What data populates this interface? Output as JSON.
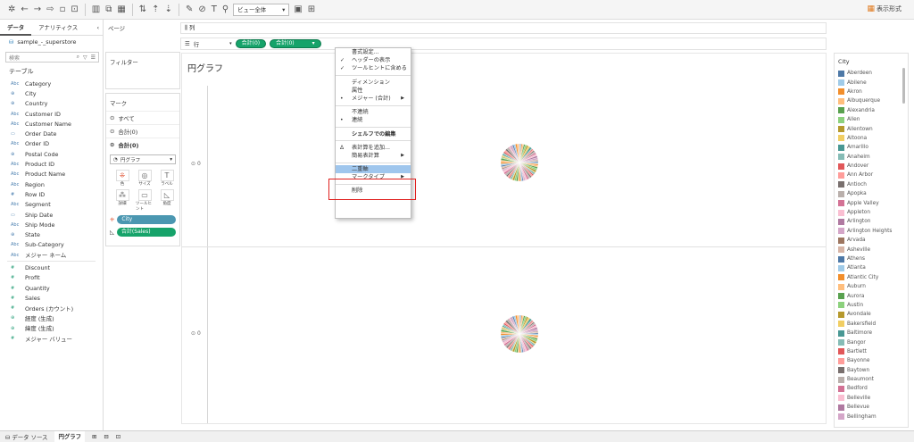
{
  "toolbar": {
    "view_select": "ビュー全体",
    "show_me": "表示形式"
  },
  "left_panel": {
    "tabs": [
      "データ",
      "アナリティクス"
    ],
    "datasource": "sample_-_superstore",
    "search_placeholder": "検索",
    "tables_header": "テーブル",
    "fields": [
      {
        "type": "Abc",
        "name": "Category"
      },
      {
        "type": "⊕",
        "name": "City"
      },
      {
        "type": "⊕",
        "name": "Country"
      },
      {
        "type": "Abc",
        "name": "Customer ID"
      },
      {
        "type": "Abc",
        "name": "Customer Name"
      },
      {
        "type": "▭",
        "name": "Order Date"
      },
      {
        "type": "Abc",
        "name": "Order ID"
      },
      {
        "type": "⊕",
        "name": "Postal Code"
      },
      {
        "type": "Abc",
        "name": "Product ID"
      },
      {
        "type": "Abc",
        "name": "Product Name"
      },
      {
        "type": "Abc",
        "name": "Region"
      },
      {
        "type": "#",
        "name": "Row ID"
      },
      {
        "type": "Abc",
        "name": "Segment"
      },
      {
        "type": "▭",
        "name": "Ship Date"
      },
      {
        "type": "Abc",
        "name": "Ship Mode"
      },
      {
        "type": "⊕",
        "name": "State"
      },
      {
        "type": "Abc",
        "name": "Sub-Category"
      },
      {
        "type": "Abc",
        "name": "メジャー ネーム"
      }
    ],
    "measures": [
      {
        "type": "#",
        "name": "Discount"
      },
      {
        "type": "#",
        "name": "Profit"
      },
      {
        "type": "#",
        "name": "Quantity"
      },
      {
        "type": "#",
        "name": "Sales"
      },
      {
        "type": "#",
        "name": "Orders (カウント)"
      },
      {
        "type": "⊕",
        "name": "経度 (生成)"
      },
      {
        "type": "⊕",
        "name": "緯度 (生成)"
      },
      {
        "type": "#",
        "name": "メジャー バリュー"
      }
    ]
  },
  "pages_label": "ページ",
  "filters_label": "フィルター",
  "marks": {
    "header": "マーク",
    "rows": [
      "すべて",
      "合計(0)",
      "合計(0)"
    ],
    "mark_type": "円グラフ",
    "buttons": [
      "色",
      "サイズ",
      "ラベル",
      "詳細",
      "ツールヒント",
      "角度"
    ],
    "pill_city": "City",
    "pill_sales": "合計(Sales)"
  },
  "shelves": {
    "columns_label": "列",
    "rows_label": "行",
    "pill1": "合計(0)",
    "pill2": "合計(0)"
  },
  "view": {
    "title": "円グラフ",
    "row_label": "0"
  },
  "legend": {
    "title": "City",
    "items": [
      {
        "name": "Aberdeen",
        "color": "#4e79a7"
      },
      {
        "name": "Abilene",
        "color": "#a0cbe8"
      },
      {
        "name": "Akron",
        "color": "#f28e2b"
      },
      {
        "name": "Albuquerque",
        "color": "#ffbe7d"
      },
      {
        "name": "Alexandria",
        "color": "#59a14f"
      },
      {
        "name": "Allen",
        "color": "#8cd17d"
      },
      {
        "name": "Allentown",
        "color": "#b6992d"
      },
      {
        "name": "Altoona",
        "color": "#f1ce63"
      },
      {
        "name": "Amarillo",
        "color": "#499894"
      },
      {
        "name": "Anaheim",
        "color": "#86bcb6"
      },
      {
        "name": "Andover",
        "color": "#e15759"
      },
      {
        "name": "Ann Arbor",
        "color": "#ff9d9a"
      },
      {
        "name": "Antioch",
        "color": "#79706e"
      },
      {
        "name": "Apopka",
        "color": "#bab0ac"
      },
      {
        "name": "Apple Valley",
        "color": "#d37295"
      },
      {
        "name": "Appleton",
        "color": "#fabfd2"
      },
      {
        "name": "Arlington",
        "color": "#b07aa1"
      },
      {
        "name": "Arlington Heights",
        "color": "#d4a6c8"
      },
      {
        "name": "Arvada",
        "color": "#9d7660"
      },
      {
        "name": "Asheville",
        "color": "#d7b5a6"
      },
      {
        "name": "Athens",
        "color": "#4e79a7"
      },
      {
        "name": "Atlanta",
        "color": "#a0cbe8"
      },
      {
        "name": "Atlantic City",
        "color": "#f28e2b"
      },
      {
        "name": "Auburn",
        "color": "#ffbe7d"
      },
      {
        "name": "Aurora",
        "color": "#59a14f"
      },
      {
        "name": "Austin",
        "color": "#8cd17d"
      },
      {
        "name": "Avondale",
        "color": "#b6992d"
      },
      {
        "name": "Bakersfield",
        "color": "#f1ce63"
      },
      {
        "name": "Baltimore",
        "color": "#499894"
      },
      {
        "name": "Bangor",
        "color": "#86bcb6"
      },
      {
        "name": "Bartlett",
        "color": "#e15759"
      },
      {
        "name": "Bayonne",
        "color": "#ff9d9a"
      },
      {
        "name": "Baytown",
        "color": "#79706e"
      },
      {
        "name": "Beaumont",
        "color": "#bab0ac"
      },
      {
        "name": "Bedford",
        "color": "#d37295"
      },
      {
        "name": "Belleville",
        "color": "#fabfd2"
      },
      {
        "name": "Bellevue",
        "color": "#b07aa1"
      },
      {
        "name": "Bellingham",
        "color": "#d4a6c8"
      }
    ]
  },
  "context_menu": {
    "items": [
      {
        "label": "書式設定...",
        "pre": "",
        "arrow": false
      },
      {
        "label": "ヘッダーの表示",
        "pre": "✓",
        "arrow": false
      },
      {
        "label": "ツールヒントに含める",
        "pre": "✓",
        "arrow": false
      },
      {
        "sep": true
      },
      {
        "label": "ディメンション",
        "pre": "",
        "arrow": false
      },
      {
        "label": "属性",
        "pre": "",
        "arrow": false
      },
      {
        "label": "メジャー (合計)",
        "pre": "•",
        "arrow": true
      },
      {
        "sep": true
      },
      {
        "label": "不連続",
        "pre": "",
        "arrow": false
      },
      {
        "label": "連続",
        "pre": "•",
        "arrow": false
      },
      {
        "sep": true
      },
      {
        "label": "シェルフでの編集",
        "pre": "",
        "arrow": false,
        "bold": true
      },
      {
        "sep": true
      },
      {
        "label": "表計算を追加...",
        "pre": "Δ",
        "arrow": false
      },
      {
        "label": "簡易表計算",
        "pre": "",
        "arrow": true
      },
      {
        "sep": true
      },
      {
        "label": "二重軸",
        "pre": "",
        "arrow": false,
        "highlight": true
      },
      {
        "label": "マークタイプ",
        "pre": "",
        "arrow": true
      },
      {
        "sep": true
      },
      {
        "label": "削除",
        "pre": "",
        "arrow": false
      }
    ]
  },
  "bottom": {
    "tabs": [
      "データ ソース",
      "円グラフ"
    ]
  }
}
